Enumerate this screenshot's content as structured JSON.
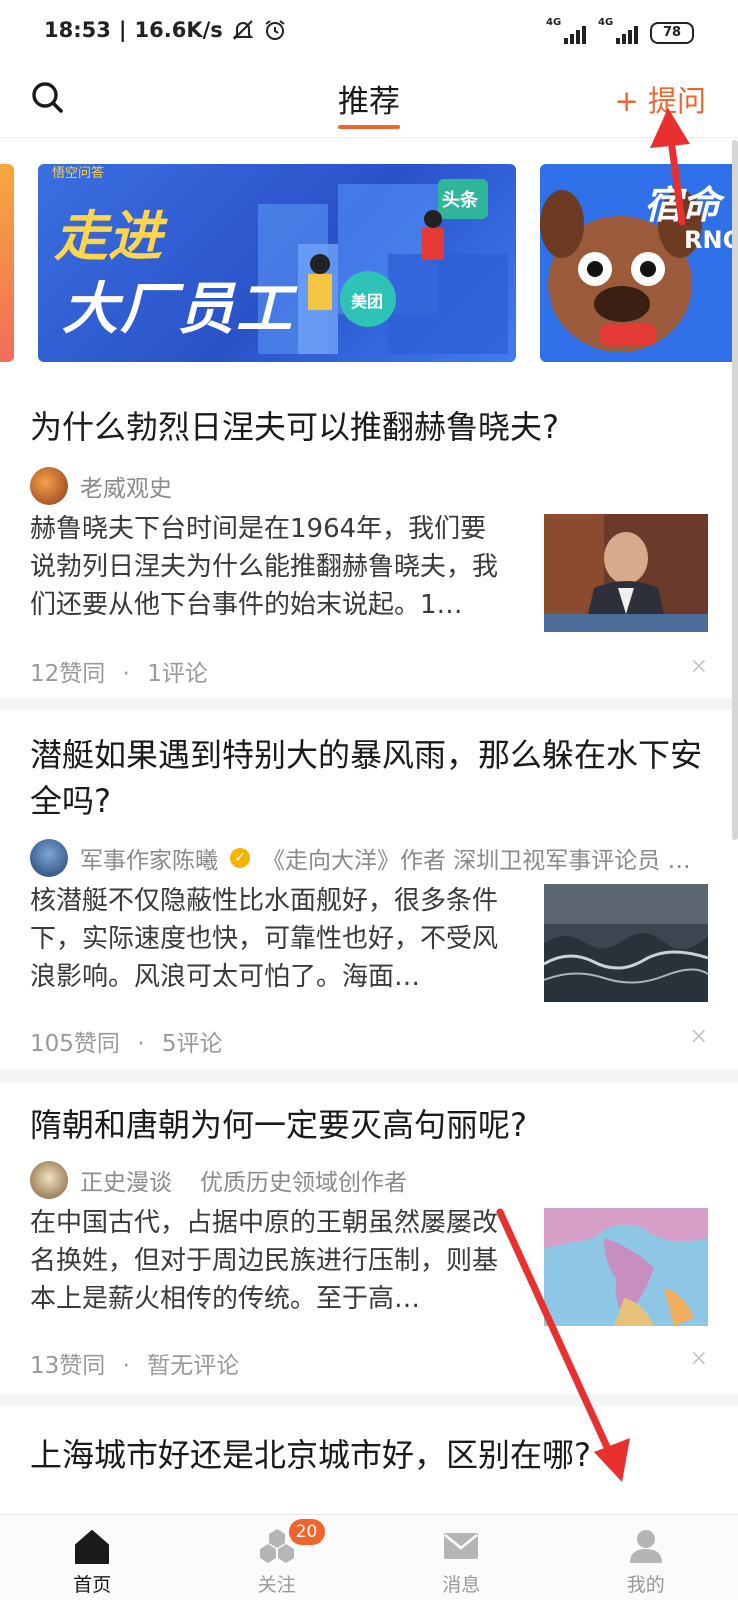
{
  "status_bar": {
    "time": "18:53",
    "net_speed": "16.6K/s",
    "signal_1": "4G",
    "signal_2": "4G",
    "battery": "78"
  },
  "header": {
    "tab_label": "推荐",
    "ask_label": "+ 提问"
  },
  "banners": {
    "main_title_line1": "走进",
    "main_title_line2": "大厂员工",
    "main_tag": "头条",
    "main_badge": "美团",
    "main_brand": "悟空问答",
    "right_title": "宿命",
    "right_sub": "RNG"
  },
  "feed": [
    {
      "title": "为什么勃烈日涅夫可以推翻赫鲁晓夫?",
      "author": "老威观史",
      "author_desc": "",
      "verified": false,
      "excerpt": "赫鲁晓夫下台时间是在1964年，我们要说勃列日涅夫为什么能推翻赫鲁晓夫，我们还要从他下台事件的始末说起。1…",
      "likes": "12赞同",
      "comments": "1评论"
    },
    {
      "title": "潜艇如果遇到特别大的暴风雨，那么躲在水下安全吗?",
      "author": "军事作家陈曦",
      "author_desc": "《走向大洋》作者 深圳卫视军事评论员 …",
      "verified": true,
      "excerpt": "核潜艇不仅隐蔽性比水面舰好，很多条件下，实际速度也快，可靠性也好，不受风浪影响。风浪可太可怕了。海面…",
      "likes": "105赞同",
      "comments": "5评论"
    },
    {
      "title": "隋朝和唐朝为何一定要灭高句丽呢?",
      "author": "正史漫谈",
      "author_desc": "优质历史领域创作者",
      "verified": false,
      "excerpt": "在中国古代，占据中原的王朝虽然屡屡改名换姓，但对于周边民族进行压制，则基本上是薪火相传的传统。至于高…",
      "likes": "13赞同",
      "comments": "暂无评论"
    },
    {
      "title": "上海城市好还是北京城市好，区别在哪?"
    }
  ],
  "meta_separator": "·",
  "dismiss_glyph": "×",
  "bottom_nav": [
    {
      "label": "首页",
      "icon": "home-icon",
      "active": true
    },
    {
      "label": "关注",
      "icon": "follow-icon",
      "badge": "20"
    },
    {
      "label": "消息",
      "icon": "message-icon"
    },
    {
      "label": "我的",
      "icon": "profile-icon"
    }
  ],
  "colors": {
    "accent": "#f0642d",
    "annotation": "#e8312f"
  }
}
